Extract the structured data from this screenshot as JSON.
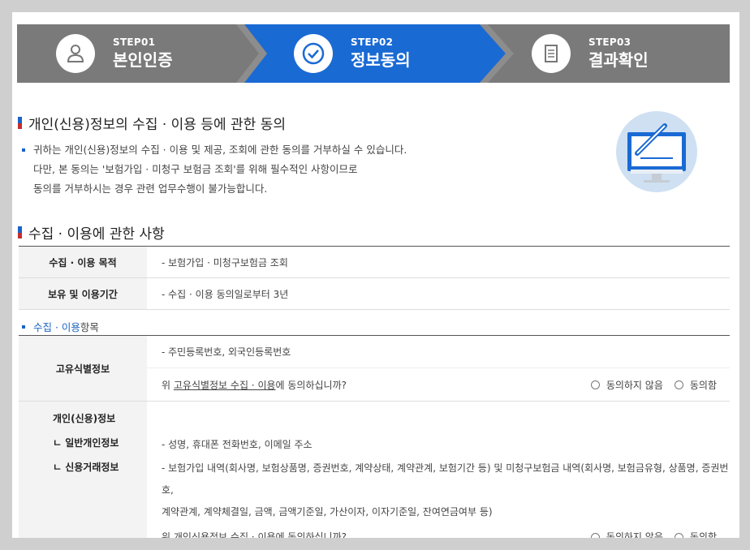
{
  "steps": [
    {
      "num": "STEP01",
      "title": "본인인증",
      "icon": "person-icon",
      "active": false
    },
    {
      "num": "STEP02",
      "title": "정보동의",
      "icon": "check-circle-icon",
      "active": true
    },
    {
      "num": "STEP03",
      "title": "결과확인",
      "icon": "document-icon",
      "active": false
    }
  ],
  "colors": {
    "step_inactive": "#7a7a7a",
    "step_active": "#1a6ad4",
    "accent": "#1a63c6"
  },
  "consent": {
    "heading": "개인(신용)정보의 수집 · 이용 등에 관한 동의",
    "lines": [
      "귀하는 개인(신용)정보의 수집 · 이용 및 제공, 조회에 관한 동의를 거부하실 수 있습니다.",
      "다만, 본 동의는 '보험가입 · 미청구 보험금 조회'를 위해 필수적인 사항이므로",
      "동의를 거부하시는 경우 관련 업무수행이 불가능합니다."
    ]
  },
  "usage": {
    "heading": "수집 · 이용에 관한 사항",
    "rows": [
      {
        "label": "수집 · 이용 목적",
        "value": "- 보험가입 · 미청구보험금 조회"
      },
      {
        "label": "보유 및 이용기간",
        "value": "- 수집 · 이용 동의일로부터 3년"
      }
    ]
  },
  "items": {
    "sub_heading_blue": "수집 · 이용",
    "sub_heading_rest": " 항목",
    "unique": {
      "label": "고유식별정보",
      "value": "- 주민등록번호, 외국인등록번호",
      "question_prefix": "위 ",
      "question_link": "고유식별정보 수집 · 이용",
      "question_suffix": "에 동의하십니까?",
      "disagree": "동의하지 않음",
      "agree": "동의함"
    },
    "personal": {
      "label": "개인(신용)정보",
      "sub1": "ㄴ 일반개인정보",
      "sub2": "ㄴ 신용거래정보",
      "value1": "- 성명, 휴대폰 전화번호, 이메일 주소",
      "value2": "- 보험가입 내역(회사명, 보험상품명, 증권번호, 계약상태, 계약관계, 보험기간 등) 및 미청구보험금 내역(회사명, 보험금유형, 상품명, 증권번호,",
      "value3": "계약관계, 계약체결일, 금액, 금액기준일, 가산이자, 이자기준일, 잔여연금여부 등)",
      "question_prefix": "위 ",
      "question_link": "개인신용정보 수집 · 이용",
      "question_suffix": "에 동의하십니까?",
      "disagree": "동의하지 않음",
      "agree": "동의함"
    }
  }
}
